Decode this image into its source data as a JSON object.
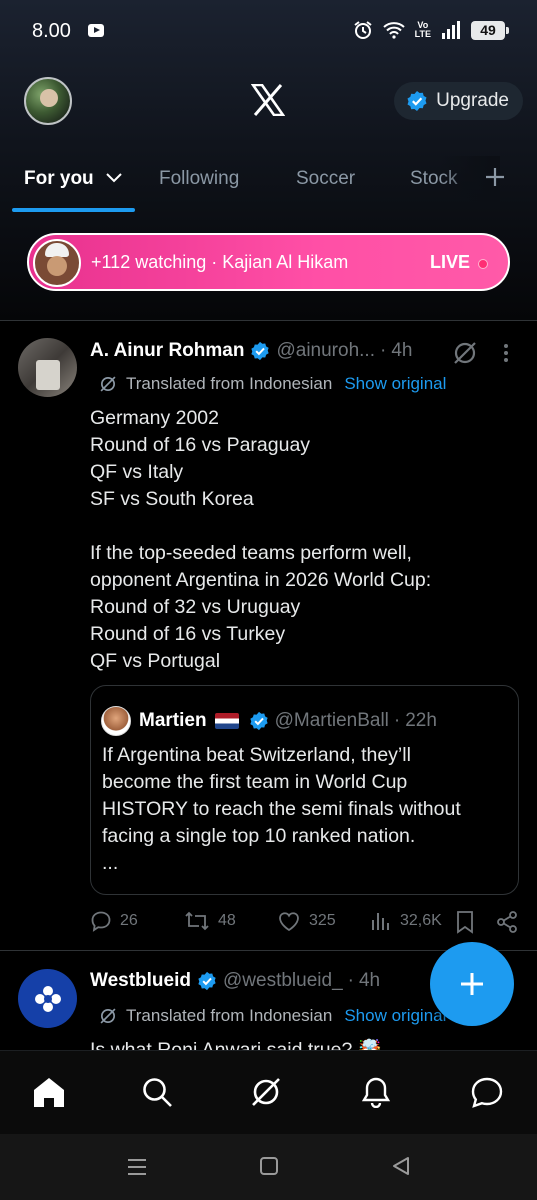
{
  "status_bar": {
    "time": "8.00",
    "battery": "49",
    "network": "Vo LTE"
  },
  "header": {
    "logo": "x-logo-icon",
    "upgrade_label": "Upgrade"
  },
  "tabs": [
    {
      "label": "For you",
      "active": true
    },
    {
      "label": "Following",
      "active": false
    },
    {
      "label": "Soccer",
      "active": false
    },
    {
      "label": "Stock",
      "active": false
    }
  ],
  "live": {
    "text": "+112 watching · Kajian Al Hikam",
    "badge": "LIVE"
  },
  "post": {
    "author": "A. Ainur Rohman",
    "handle": "@ainuroh...",
    "separator": "·",
    "time": "4h",
    "translated_label": "Translated from Indonesian",
    "show_original": "Show original",
    "body": [
      "Germany 2002",
      "Round of 16 vs Paraguay",
      "QF vs Italy",
      "SF vs South Korea",
      "",
      "If the top-seeded teams perform well,",
      "opponent Argentina in 2026 World Cup:",
      "Round of 32 vs Uruguay",
      "Round of 16 vs Turkey",
      "QF vs Portugal"
    ],
    "quote": {
      "author": "Martien",
      "handle": "@MartienBall",
      "separator": "·",
      "time": "22h",
      "body": [
        "If Argentina beat Switzerland, they’ll",
        "become the first team in World Cup",
        "HISTORY to reach the semi finals without",
        "facing a single top 10 ranked nation.",
        "..."
      ]
    },
    "stats": {
      "replies": "26",
      "reposts": "48",
      "likes": "325",
      "views": "32,6K"
    }
  },
  "post2": {
    "author": "Westblueid",
    "handle": "@westblueid_",
    "separator": "·",
    "time": "4h",
    "translated_label": "Translated from Indonesian",
    "show_original": "Show original",
    "body": "Is what Roni Anwari said true? 🤯"
  },
  "colors": {
    "accent": "#1d9bf0",
    "live_start": "#e8318e",
    "live_end": "#ff5aa8",
    "background": "#000000"
  }
}
